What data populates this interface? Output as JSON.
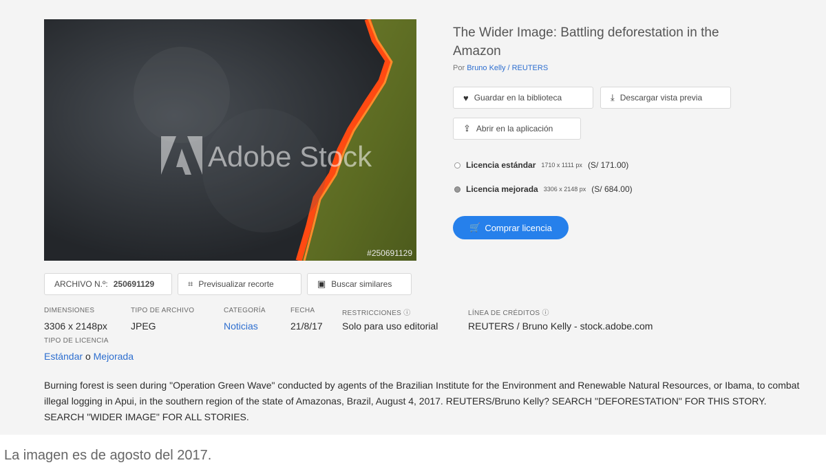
{
  "photo": {
    "watermark": "Adobe Stock",
    "id_number": "#250691129"
  },
  "title": "The Wider Image: Battling deforestation in the Amazon",
  "byline": {
    "prefix": "Por",
    "author": "Bruno Kelly / REUTERS"
  },
  "actions": {
    "save": "Guardar en la biblioteca",
    "download": "Descargar vista previa",
    "open_app": "Abrir en la aplicación"
  },
  "licenses": [
    {
      "name": "Licencia estándar",
      "size": "1710 x 1111 px",
      "price": "(S/ 171.00)",
      "selected": false
    },
    {
      "name": "Licencia mejorada",
      "size": "3306 x 2148 px",
      "price": "(S/ 684.00)",
      "selected": true
    }
  ],
  "buy_label": "Comprar licencia",
  "file_row": {
    "file_label": "ARCHIVO N.º:",
    "file_number": "250691129",
    "crop": "Previsualizar recorte",
    "similar": "Buscar similares"
  },
  "meta": {
    "dimensions_h": "DIMENSIONES",
    "dimensions_v": "3306 x 2148px",
    "filetype_h": "TIPO DE ARCHIVO",
    "filetype_v": "JPEG",
    "category_h": "CATEGORÍA",
    "category_v": "Noticias",
    "date_h": "FECHA",
    "date_v": "21/8/17",
    "restrictions_h": "RESTRICCIONES",
    "restrictions_v": "Solo para uso editorial",
    "credits_h": "LÍNEA DE CRÉDITOS",
    "credits_v": "REUTERS / Bruno Kelly - stock.adobe.com",
    "license_type_h": "TIPO DE LICENCIA",
    "license_std": "Estándar",
    "license_or": "o",
    "license_ext": "Mejorada"
  },
  "description": "Burning forest is seen during \"Operation Green Wave\" conducted by agents of the Brazilian Institute for the Environment and Renewable Natural Resources, or Ibama, to combat illegal logging in Apui, in the southern region of the state of Amazonas, Brazil, August 4, 2017. REUTERS/Bruno Kelly? SEARCH \"DEFORESTATION\" FOR THIS STORY. SEARCH \"WIDER IMAGE\" FOR ALL STORIES.",
  "caption": "La imagen es de agosto del 2017.",
  "colors": {
    "accent": "#2680eb",
    "link": "#2d6ecf",
    "panel": "#f4f4f4"
  }
}
